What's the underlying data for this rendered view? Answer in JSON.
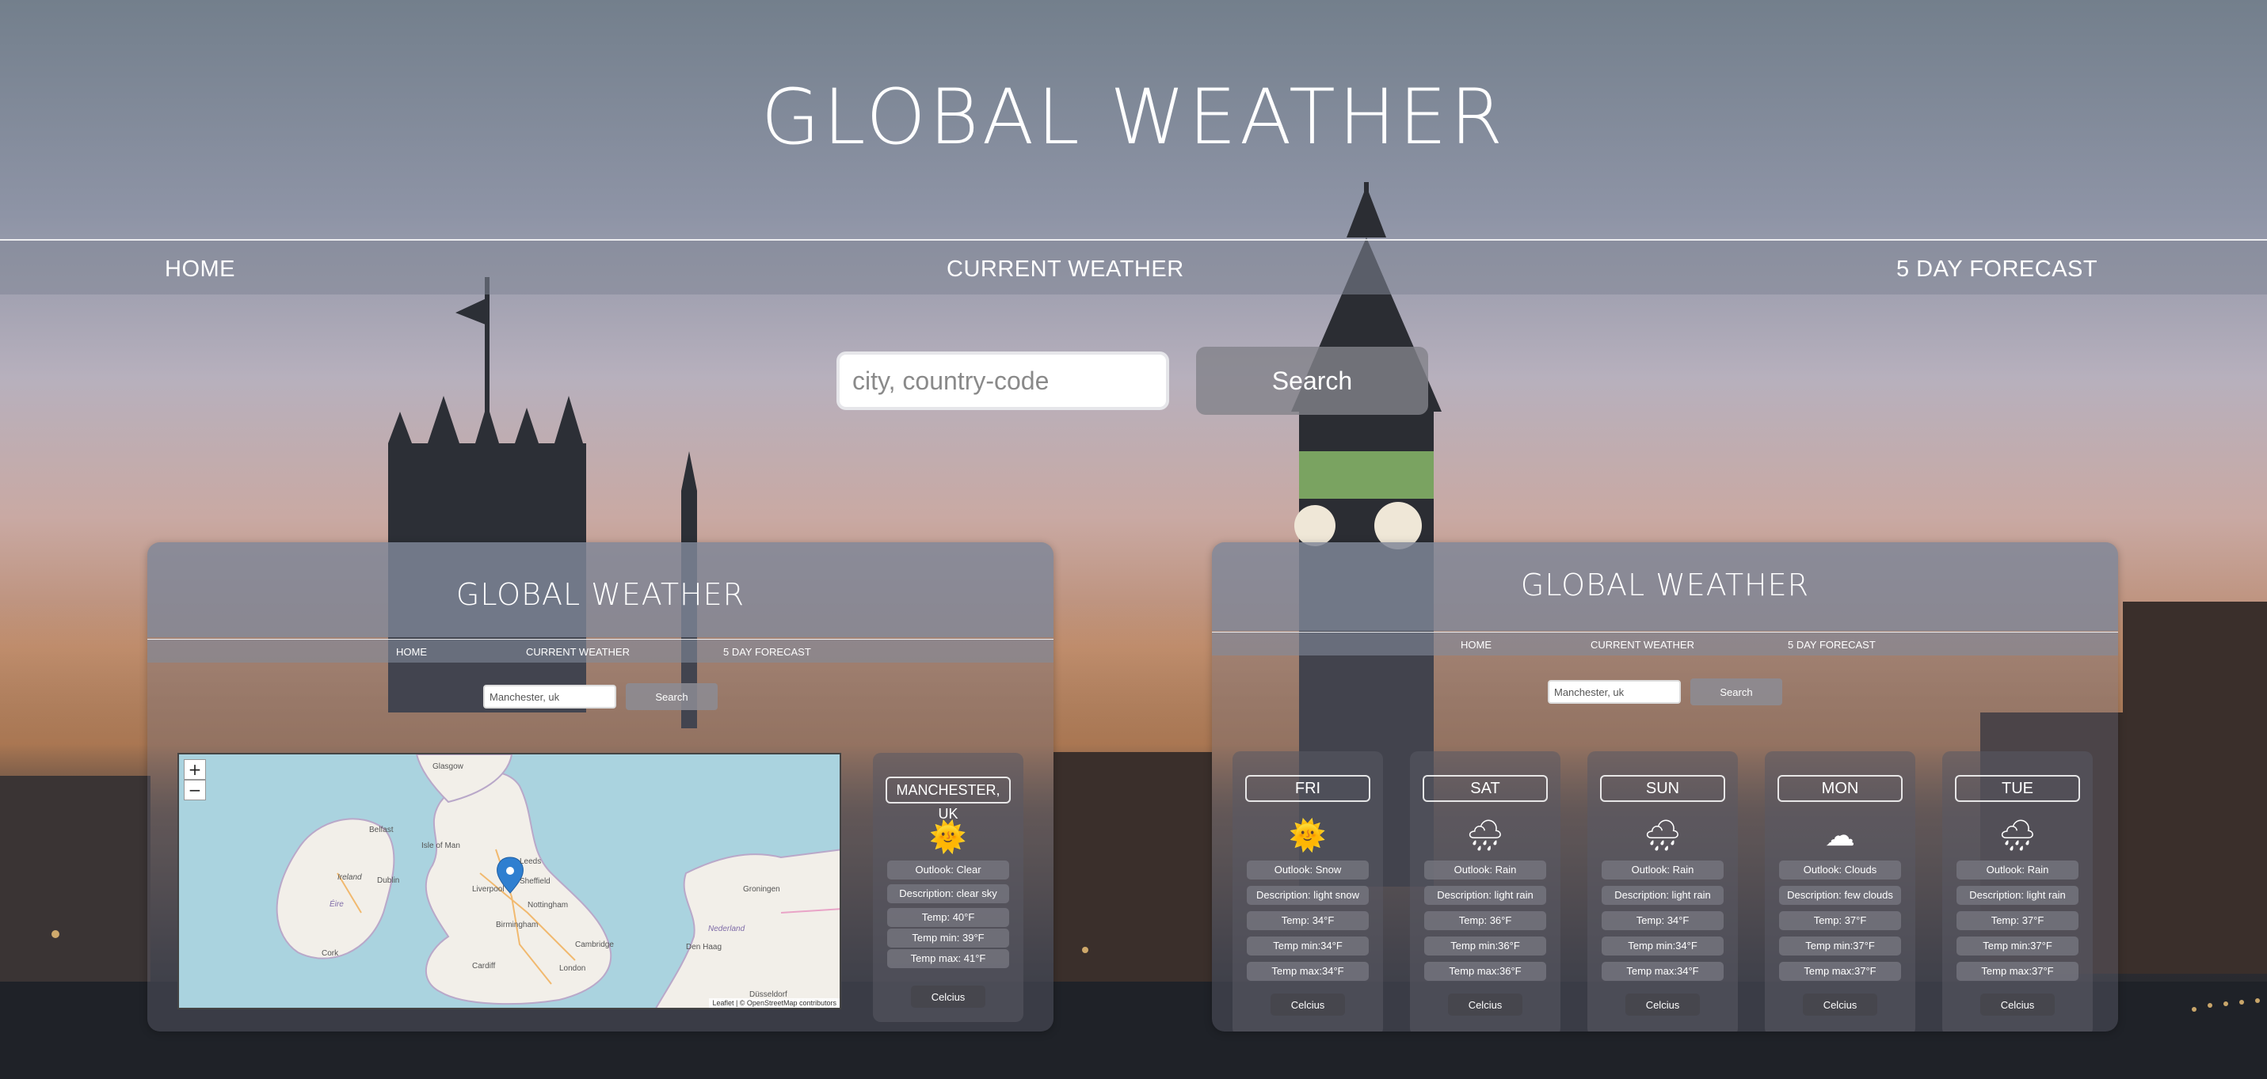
{
  "header": {
    "title": "GLOBAL WEATHER"
  },
  "nav": {
    "home": "HOME",
    "current": "CURRENT WEATHER",
    "forecast": "5 DAY FORECAST"
  },
  "search": {
    "placeholder": "city, country-code",
    "button": "Search"
  },
  "preview_current": {
    "title": "GLOBAL WEATHER",
    "nav": {
      "home": "HOME",
      "current": "CURRENT WEATHER",
      "forecast": "5 DAY FORECAST"
    },
    "search_value": "Manchester, uk",
    "search_button": "Search",
    "map": {
      "zoom_in": "+",
      "zoom_out": "−",
      "labels": [
        "Glasgow",
        "Isle of Man",
        "Ireland",
        "Éire",
        "Dublin",
        "Belfast",
        "Leeds",
        "Liverpool",
        "Sheffield",
        "Nottingham",
        "Birmingham",
        "Cardiff",
        "London",
        "Cambridge",
        "Nederland",
        "Den Haag",
        "Düsseldorf",
        "Cork",
        "Groningen"
      ],
      "attribution": "Leaflet | © OpenStreetMap contributors"
    },
    "card": {
      "city": "MANCHESTER, UK",
      "icon": "sun-icon",
      "outlook": "Outlook: Clear",
      "description": "Description: clear sky",
      "temp": "Temp: 40°F",
      "temp_min": "Temp min: 39°F",
      "temp_max": "Temp max: 41°F",
      "button": "Celcius"
    }
  },
  "preview_forecast": {
    "title": "GLOBAL WEATHER",
    "nav": {
      "home": "HOME",
      "current": "CURRENT WEATHER",
      "forecast": "5 DAY FORECAST"
    },
    "search_value": "Manchester, uk",
    "search_button": "Search",
    "days": [
      {
        "day": "FRI",
        "icon": "sun-icon",
        "outlook": "Outlook: Snow",
        "description": "Description: light snow",
        "temp": "Temp: 34°F",
        "temp_min": "Temp min:34°F",
        "temp_max": "Temp max:34°F",
        "button": "Celcius"
      },
      {
        "day": "SAT",
        "icon": "rain-cloud-icon",
        "outlook": "Outlook: Rain",
        "description": "Description: light rain",
        "temp": "Temp: 36°F",
        "temp_min": "Temp min:36°F",
        "temp_max": "Temp max:36°F",
        "button": "Celcius"
      },
      {
        "day": "SUN",
        "icon": "rain-cloud-icon",
        "outlook": "Outlook: Rain",
        "description": "Description: light rain",
        "temp": "Temp: 34°F",
        "temp_min": "Temp min:34°F",
        "temp_max": "Temp max:34°F",
        "button": "Celcius"
      },
      {
        "day": "MON",
        "icon": "cloud-icon",
        "outlook": "Outlook: Clouds",
        "description": "Description: few clouds",
        "temp": "Temp: 37°F",
        "temp_min": "Temp min:37°F",
        "temp_max": "Temp max:37°F",
        "button": "Celcius"
      },
      {
        "day": "TUE",
        "icon": "rain-cloud-icon",
        "outlook": "Outlook: Rain",
        "description": "Description: light rain",
        "temp": "Temp: 37°F",
        "temp_min": "Temp min:37°F",
        "temp_max": "Temp max:37°F",
        "button": "Celcius"
      }
    ]
  },
  "glyphs": {
    "sun-icon": "🌞",
    "rain-cloud-icon": "🌧",
    "cloud-icon": "☁"
  },
  "colors": {
    "accent_header": "#828a9b",
    "card_bg": "#5a5a64",
    "button_bg": "#46464c"
  }
}
